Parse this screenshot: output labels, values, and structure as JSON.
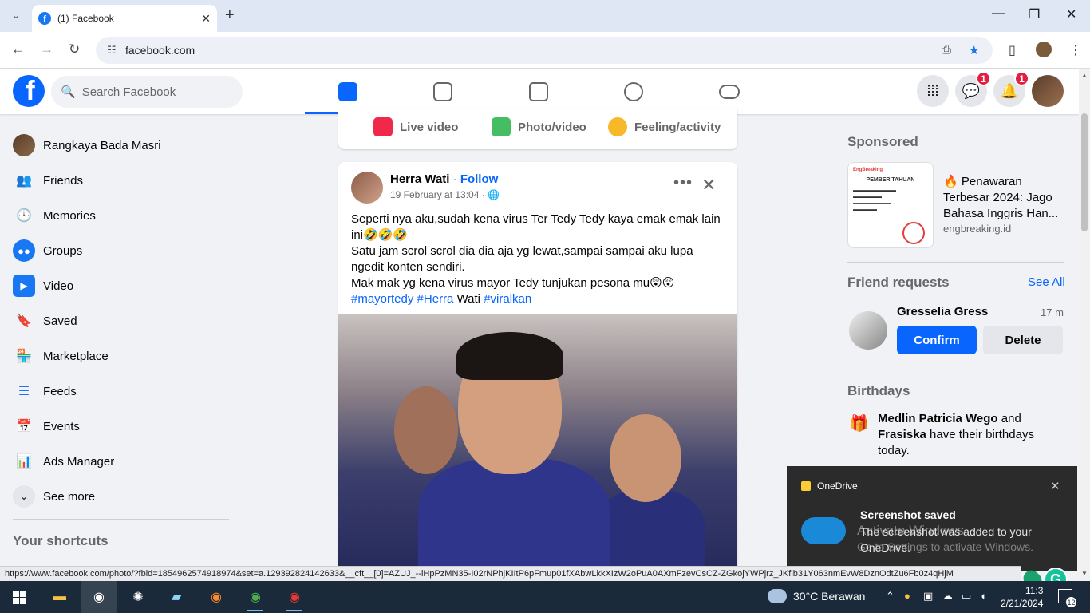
{
  "browser": {
    "tab_title": "(1) Facebook",
    "tab_close": "✕",
    "new_tab": "+",
    "url": "facebook.com",
    "controls": {
      "minimize": "—",
      "restore": "❐",
      "close": "✕"
    },
    "nav": {
      "back": "←",
      "forward": "→",
      "reload": "↻"
    },
    "status_url": "https://www.facebook.com/photo/?fbid=1854962574918974&set=a.129392824142633&__cft__[0]=AZUJ_--iHpPzMN35-I02rNPhjKIItP6pFmup01fXAbwLkkXIzW2oPuA0AXmFzevCsCZ-ZGkojYWPjrz_JKfib31Y063nmEvW8DznOdtZu6Fb0z4qHjM"
  },
  "header": {
    "logo": "f",
    "search_placeholder": "Search Facebook",
    "messenger_badge": "1",
    "notifications_badge": "1"
  },
  "sidebar": {
    "items": [
      {
        "label": "Rangkaya Bada Masri",
        "icon": "user-avatar"
      },
      {
        "label": "Friends",
        "icon": "friends-icon"
      },
      {
        "label": "Memories",
        "icon": "memories-icon"
      },
      {
        "label": "Groups",
        "icon": "groups-icon"
      },
      {
        "label": "Video",
        "icon": "video-icon"
      },
      {
        "label": "Saved",
        "icon": "saved-icon"
      },
      {
        "label": "Marketplace",
        "icon": "marketplace-icon"
      },
      {
        "label": "Feeds",
        "icon": "feeds-icon"
      },
      {
        "label": "Events",
        "icon": "events-icon"
      },
      {
        "label": "Ads Manager",
        "icon": "ads-manager-icon"
      },
      {
        "label": "See more",
        "icon": "chevron-down-icon"
      }
    ],
    "shortcuts_title": "Your shortcuts"
  },
  "composer": {
    "live_video": "Live video",
    "photo_video": "Photo/video",
    "feeling": "Feeling/activity"
  },
  "post": {
    "author": "Herra Wati",
    "separator": "·",
    "follow": "Follow",
    "date": "19 February at 13:04 · 🌐",
    "more": "•••",
    "close": "✕",
    "line1": "Seperti nya aku,sudah kena virus Ter Tedy Tedy kaya emak emak lain ini🤣🤣🤣",
    "line2": "Satu jam scrol scrol dia dia aja yg lewat,sampai sampai aku lupa ngedit konten sendiri.",
    "line3": "Mak mak yg kena virus mayor Tedy tunjukan pesona mu😲😲",
    "tag1": "#mayortedy",
    "tag2": "#Herra",
    "tag2_rest": " Wati ",
    "tag3": "#viralkan"
  },
  "right": {
    "sponsored_title": "Sponsored",
    "ad": {
      "image_brand": "EngBreaking",
      "image_title": "PEMBERITAHUAN",
      "title": "🔥 Penawaran Terbesar 2024: Jago Bahasa Inggris Han...",
      "domain": "engbreaking.id"
    },
    "friend_requests_title": "Friend requests",
    "see_all": "See All",
    "request": {
      "name": "Gresselia Gress",
      "time": "17 m",
      "confirm": "Confirm",
      "delete": "Delete"
    },
    "birthdays_title": "Birthdays",
    "birthday": {
      "name1": "Medlin Patricia Wego",
      "and": " and ",
      "name2": "Frasiska",
      "rest": " have their birthdays today."
    }
  },
  "toast": {
    "app": "OneDrive",
    "close": "✕",
    "title": "Screenshot saved",
    "body": "The screenshot was added to your OneDrive.",
    "watermark1": "Activate Windows",
    "watermark2": "Go to Settings to activate Windows."
  },
  "taskbar": {
    "weather": "30°C  Berawan",
    "time": "11:3",
    "date": "2/21/2024",
    "notifications": "12"
  }
}
